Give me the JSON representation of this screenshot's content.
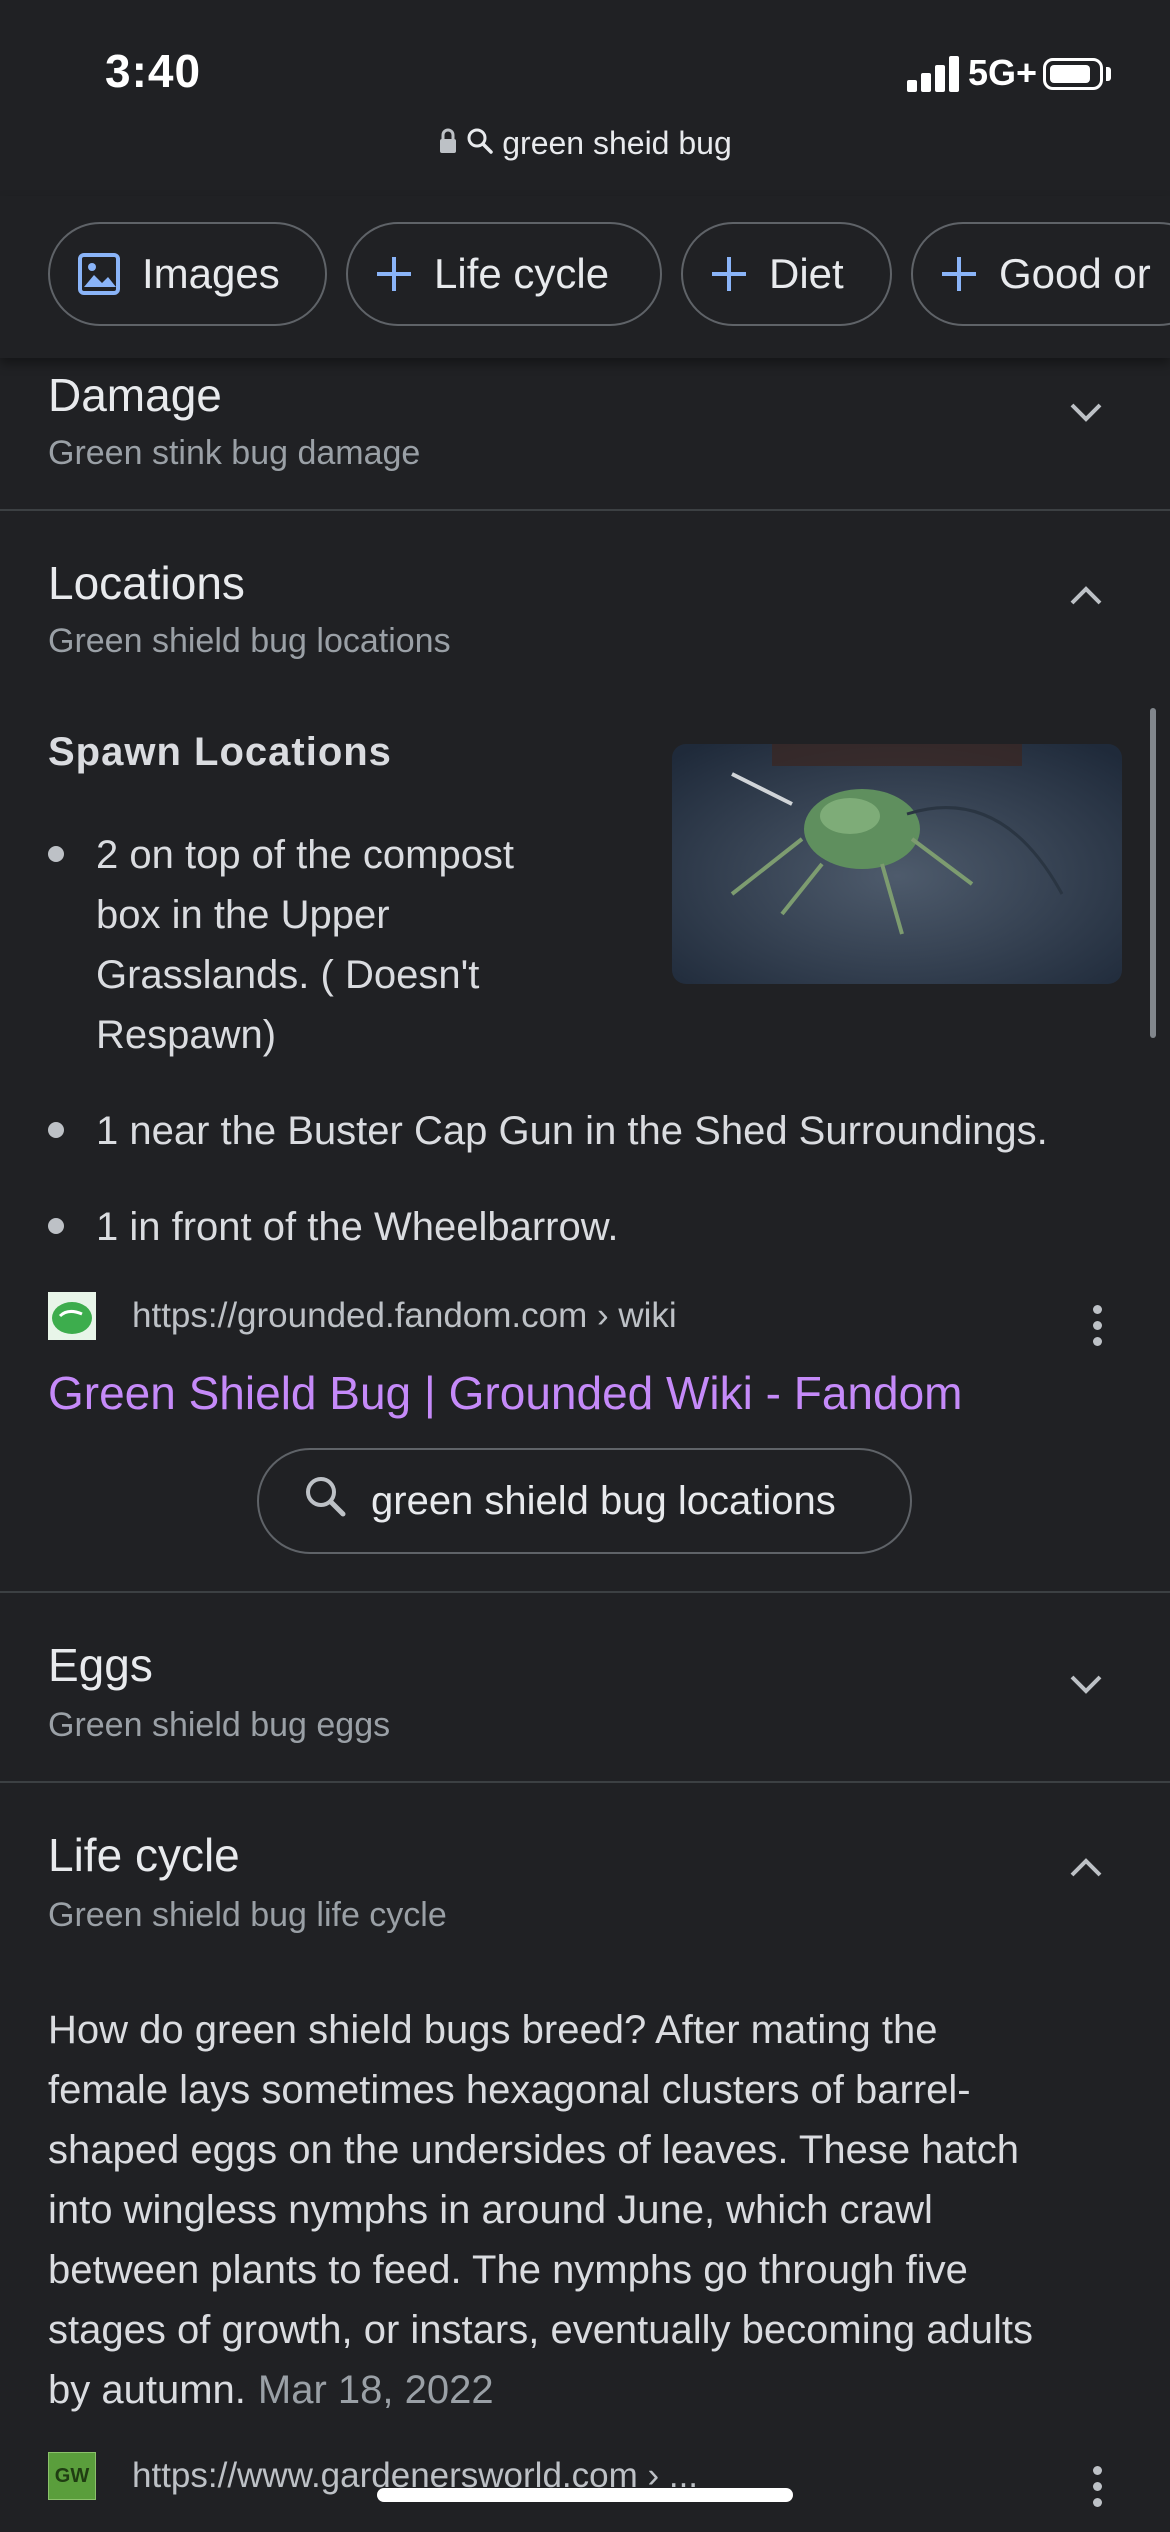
{
  "status_bar": {
    "time": "3:40",
    "network": "5G+"
  },
  "url_bar": {
    "text": "green sheid bug"
  },
  "chips": [
    {
      "label": "Images",
      "icon": "image-icon"
    },
    {
      "label": "Life cycle",
      "icon": "plus-icon"
    },
    {
      "label": "Diet",
      "icon": "plus-icon"
    },
    {
      "label": "Good or",
      "icon": "plus-icon"
    }
  ],
  "sections": {
    "damage": {
      "title": "Damage",
      "subtitle": "Green stink bug damage"
    },
    "locations": {
      "title": "Locations",
      "subtitle": "Green shield bug locations",
      "heading": "Spawn Locations",
      "bullets": [
        "2 on top of the compost",
        "box in the Upper",
        "Grasslands. ( Doesn't",
        "Respawn)",
        "1 near the Buster Cap Gun in the Shed Surroundings.",
        "1 in front of the Wheelbarrow."
      ],
      "source_url": "https://grounded.fandom.com › wiki",
      "source_title": "Green Shield Bug | Grounded Wiki - Fandom",
      "related_query": "green shield bug locations"
    },
    "eggs": {
      "title": "Eggs",
      "subtitle": "Green shield bug eggs"
    },
    "life_cycle": {
      "title": "Life cycle",
      "subtitle": "Green shield bug life cycle",
      "paragraph_lines": [
        "How do green shield bugs breed? After mating the",
        "female lays sometimes hexagonal clusters of barrel-",
        "shaped eggs on the undersides of leaves. These hatch",
        "into wingless nymphs in around June, which crawl",
        "between plants to feed. The nymphs go through five",
        "stages of growth, or instars, eventually becoming adults",
        "by autumn."
      ],
      "date": "Mar 18, 2022",
      "source_url": "https://www.gardenersworld.com › ...",
      "favicon_text": "GW"
    }
  },
  "colors": {
    "background": "#202124",
    "link": "#c58af9",
    "accent_blue": "#8ab4f8",
    "divider": "#3c4043"
  }
}
